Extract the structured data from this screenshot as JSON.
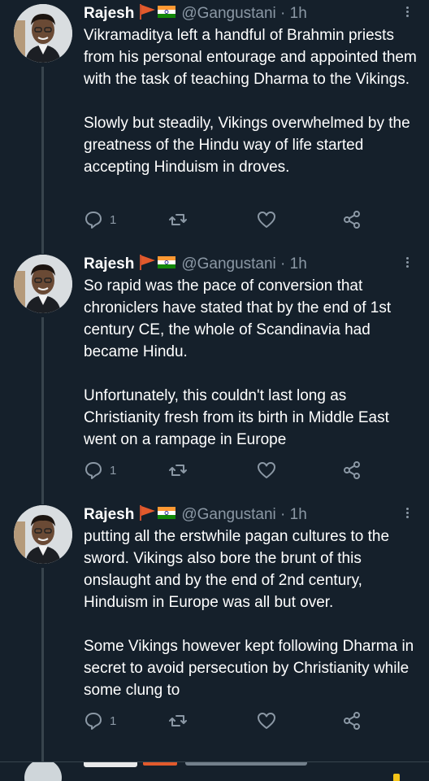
{
  "tweets": [
    {
      "name": "Rajesh",
      "handle": "@Gangustani · 1h",
      "paragraphs": [
        "Vikramaditya left a handful of Brahmin priests from his personal entourage and appointed them with the task of teaching Dharma to the Vikings.",
        "Slowly but steadily, Vikings overwhelmed by the greatness of the Hindu way of life started accepting Hinduism in droves."
      ],
      "reply_count": "1"
    },
    {
      "name": "Rajesh",
      "handle": "@Gangustani · 1h",
      "paragraphs": [
        "So rapid was the pace of conversion that chroniclers have stated that by the end of 1st century CE, the whole of Scandinavia had became Hindu.",
        "Unfortunately, this couldn't last long as Christianity fresh from its birth in Middle East went on a rampage in Europe"
      ],
      "reply_count": "1"
    },
    {
      "name": "Rajesh",
      "handle": "@Gangustani · 1h",
      "paragraphs": [
        "putting all the erstwhile pagan cultures to the sword. Vikings also bore the brunt of this onslaught and by the end of 2nd century, Hinduism in Europe was all but over.",
        "Some Vikings however kept following Dharma in secret to avoid persecution by Christianity while some clung to"
      ],
      "reply_count": "1"
    }
  ],
  "icons": {
    "reply": "reply-icon",
    "retweet": "retweet-icon",
    "like": "heart-icon",
    "share": "share-icon",
    "more": "more-vertical-icon"
  },
  "colors": {
    "background": "#15202b",
    "muted": "#8b98a5",
    "divider": "#38444d",
    "text": "#ffffff"
  }
}
